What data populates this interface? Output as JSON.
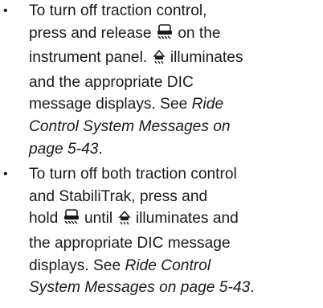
{
  "bullets": [
    {
      "bullet_char": "•",
      "icon_names": [
        "traction-off-icon",
        "traction-light-icon"
      ],
      "l1": "To turn off traction control,",
      "l2a": "press and release",
      "l2b": "on the",
      "l3": "instrument panel.",
      "l3b": "illuminates",
      "l4": "and the appropriate DIC",
      "l5a": "message displays. See",
      "l5b": "Ride",
      "l6": "Control System Messages on",
      "l7a": "page 5-43",
      "l7b": "."
    },
    {
      "bullet_char": "•",
      "icon_names": [
        "traction-off-icon",
        "traction-light-icon"
      ],
      "l1": "To turn off both traction control",
      "l2": "and StabiliTrak, press and",
      "l3a": "hold",
      "l3b": "until",
      "l3c": "illuminates and",
      "l4": "the appropriate DIC message",
      "l5a": "displays. See",
      "l5b": "Ride Control",
      "l6a": "System Messages on page 5-43",
      "l6b": "."
    }
  ]
}
